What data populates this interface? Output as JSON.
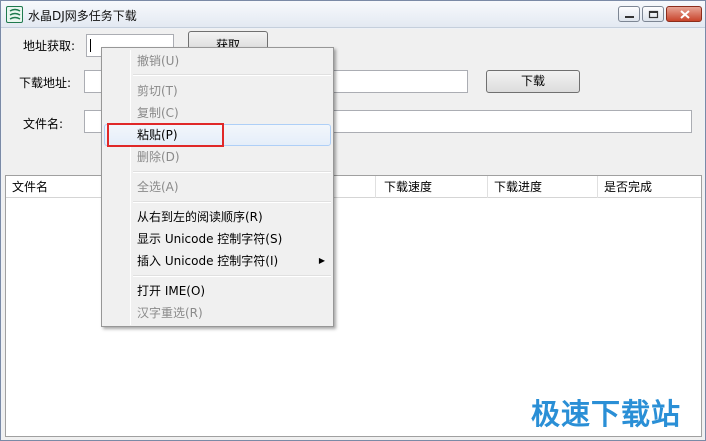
{
  "window": {
    "title": "水晶DJ网多任务下载",
    "app_icon": "app-logo-icon",
    "controls": [
      "minimize-icon",
      "maximize-icon",
      "close-icon"
    ]
  },
  "form": {
    "url_label": "地址获取:",
    "url_value": "",
    "get_button": "获取",
    "download_label": "下载地址:",
    "download_value": "",
    "download_button": "下载",
    "filename_label": "文件名:",
    "filename_value": ""
  },
  "table": {
    "columns": [
      "文件名",
      "下载速度",
      "下载进度",
      "是否完成"
    ],
    "rows": []
  },
  "context_menu": {
    "items": [
      {
        "label": "撤销(U)",
        "enabled": false
      },
      {
        "label": "剪切(T)",
        "enabled": false
      },
      {
        "label": "复制(C)",
        "enabled": false
      },
      {
        "label": "粘贴(P)",
        "enabled": true,
        "hovered": true
      },
      {
        "label": "删除(D)",
        "enabled": false
      },
      {
        "label": "全选(A)",
        "enabled": false
      },
      {
        "label": "从右到左的阅读顺序(R)",
        "enabled": true
      },
      {
        "label": "显示 Unicode 控制字符(S)",
        "enabled": true
      },
      {
        "label": "插入 Unicode 控制字符(I)",
        "enabled": true,
        "submenu": true
      },
      {
        "label": "打开 IME(O)",
        "enabled": true
      },
      {
        "label": "汉字重选(R)",
        "enabled": false
      }
    ],
    "highlight_color": "#e02828"
  },
  "watermark": "极速下载站",
  "colors": {
    "close_button": "#c8442b",
    "watermark": "#2a8fd6",
    "menu_hover_border": "#aecff7"
  }
}
